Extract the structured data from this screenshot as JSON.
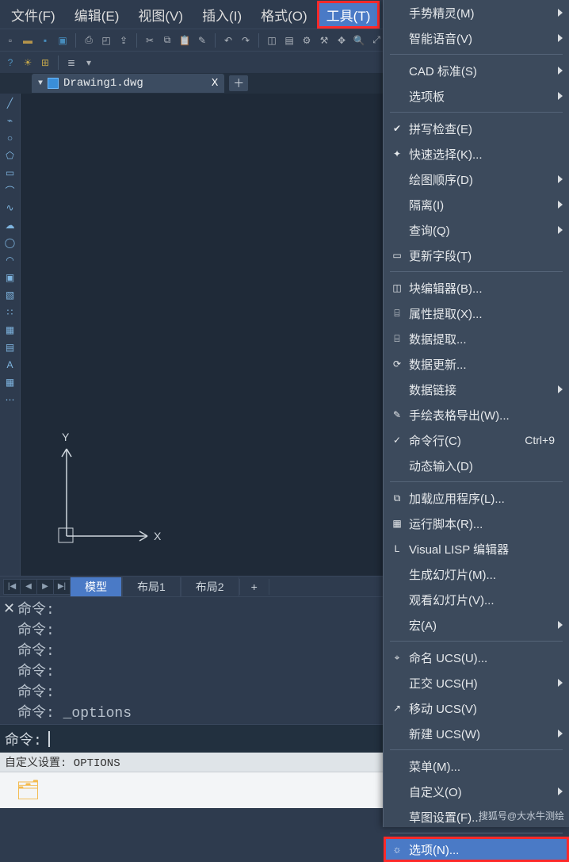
{
  "menubar": {
    "items": [
      {
        "label": "文件(F)"
      },
      {
        "label": "编辑(E)"
      },
      {
        "label": "视图(V)"
      },
      {
        "label": "插入(I)"
      },
      {
        "label": "格式(O)"
      },
      {
        "label": "工具(T)"
      }
    ],
    "active_index": 5
  },
  "toolbar1_icons": [
    "new",
    "open",
    "save",
    "saveall",
    "print",
    "printpreview",
    "publish",
    "cut",
    "copy",
    "paste",
    "match",
    "undo",
    "redo",
    "pan",
    "zoom"
  ],
  "toolbar2_icons": [
    "help",
    "sun",
    "app",
    "layer",
    "layeriso"
  ],
  "filetab": {
    "name": "Drawing1.dwg",
    "close_glyph": "X"
  },
  "left_tool_icons": [
    "line",
    "polyline",
    "circle",
    "polygon",
    "rect",
    "arc",
    "spline",
    "revcloud",
    "ellipse",
    "ellipsearc",
    "block",
    "hatch",
    "point",
    "region",
    "table",
    "text",
    "more"
  ],
  "ucs": {
    "x_label": "X",
    "y_label": "Y"
  },
  "layout_tabs": {
    "nav": [
      "|◀",
      "◀",
      "▶",
      "▶|"
    ],
    "tabs": [
      "模型",
      "布局1",
      "布局2"
    ],
    "add": "+",
    "active_index": 0
  },
  "command_history": {
    "label": "命令:",
    "lines": [
      "",
      "",
      "",
      "",
      ""
    ],
    "last": "命令: _options"
  },
  "command_input": {
    "label": "命令:",
    "value": ""
  },
  "statusbar": {
    "text": "自定义设置: OPTIONS"
  },
  "dropdown": {
    "groups": [
      [
        {
          "icon": "",
          "label": "手势精灵(M)",
          "sub": true
        },
        {
          "icon": "",
          "label": "智能语音(V)",
          "sub": true
        }
      ],
      [
        {
          "icon": "",
          "label": "CAD 标准(S)",
          "sub": true
        },
        {
          "icon": "",
          "label": "选项板",
          "sub": true
        }
      ],
      [
        {
          "icon": "✔",
          "label": "拼写检查(E)"
        },
        {
          "icon": "✦",
          "label": "快速选择(K)..."
        },
        {
          "icon": "",
          "label": "绘图顺序(D)",
          "sub": true
        },
        {
          "icon": "",
          "label": "隔离(I)",
          "sub": true
        },
        {
          "icon": "",
          "label": "查询(Q)",
          "sub": true
        },
        {
          "icon": "▭",
          "label": "更新字段(T)"
        }
      ],
      [
        {
          "icon": "◫",
          "label": "块编辑器(B)..."
        },
        {
          "icon": "⌸",
          "label": "属性提取(X)..."
        },
        {
          "icon": "⌸",
          "label": "数据提取..."
        },
        {
          "icon": "⟳",
          "label": "数据更新..."
        },
        {
          "icon": "",
          "label": "数据链接",
          "sub": true
        },
        {
          "icon": "✎",
          "label": "手绘表格导出(W)..."
        },
        {
          "icon": "✓",
          "label": "命令行(C)",
          "shortcut": "Ctrl+9"
        },
        {
          "icon": "",
          "label": "动态输入(D)"
        }
      ],
      [
        {
          "icon": "⧉",
          "label": "加载应用程序(L)..."
        },
        {
          "icon": "▦",
          "label": "运行脚本(R)..."
        },
        {
          "icon": "L",
          "label": "Visual LISP 编辑器"
        },
        {
          "icon": "",
          "label": "生成幻灯片(M)..."
        },
        {
          "icon": "",
          "label": "观看幻灯片(V)..."
        },
        {
          "icon": "",
          "label": "宏(A)",
          "sub": true
        }
      ],
      [
        {
          "icon": "⌖",
          "label": "命名 UCS(U)..."
        },
        {
          "icon": "",
          "label": "正交 UCS(H)",
          "sub": true
        },
        {
          "icon": "↗",
          "label": "移动 UCS(V)"
        },
        {
          "icon": "",
          "label": "新建 UCS(W)",
          "sub": true
        }
      ],
      [
        {
          "icon": "",
          "label": "菜单(M)..."
        },
        {
          "icon": "",
          "label": "自定义(O)",
          "sub": true
        },
        {
          "icon": "",
          "label": "草图设置(F)..."
        }
      ],
      [
        {
          "icon": "☼",
          "label": "选项(N)...",
          "selected": true
        }
      ]
    ]
  },
  "watermark": "搜狐号@大水牛测绘"
}
